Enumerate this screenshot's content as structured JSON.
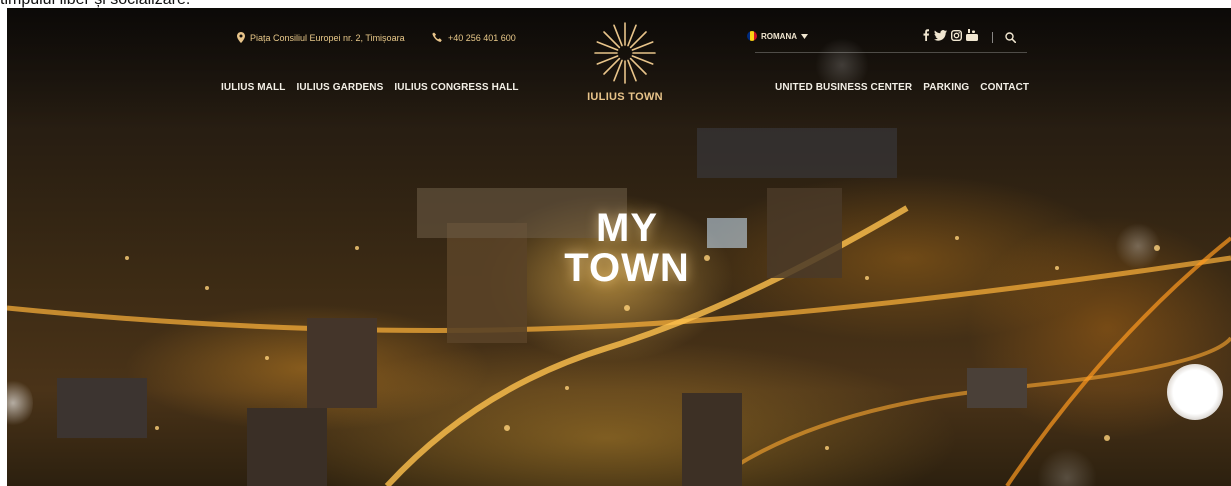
{
  "caption": "timpului liber și socializare.",
  "header": {
    "address": "Piața Consiliul Europei nr. 2, Timișoara",
    "phone": "+40 256 401 600",
    "logo_text": "IULIUS TOWN",
    "language": "ROMANA",
    "nav_left": [
      "IULIUS MALL",
      "IULIUS GARDENS",
      "IULIUS CONGRESS HALL"
    ],
    "nav_right": [
      "UNITED BUSINESS CENTER",
      "PARKING",
      "CONTACT"
    ],
    "social_icons": [
      "facebook-icon",
      "twitter-icon",
      "instagram-icon",
      "youtube-icon"
    ]
  },
  "hero": {
    "headline_line1": "MY",
    "headline_line2": "TOWN"
  },
  "colors": {
    "accent": "#e8c48a",
    "nav_text": "#f3efe6"
  }
}
